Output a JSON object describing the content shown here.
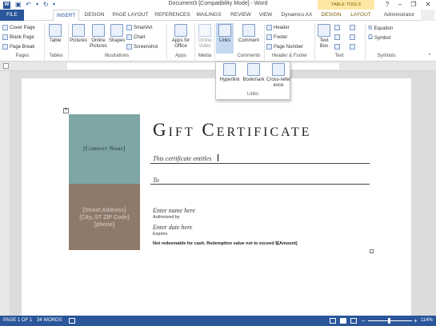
{
  "titlebar": {
    "title": "Document3 [Compatibility Mode] - Word",
    "contextual": "TABLE TOOLS",
    "help": "?",
    "min": "–",
    "restore": "❐",
    "close": "✕"
  },
  "tabs": {
    "file": "FILE",
    "insert": "INSERT",
    "design": "DESIGN",
    "page_layout": "PAGE LAYOUT",
    "references": "REFERENCES",
    "mailings": "MAILINGS",
    "review": "REVIEW",
    "view": "VIEW",
    "dynamics": "Dynamics AX",
    "tt_design": "DESIGN",
    "tt_layout": "LAYOUT",
    "user": "Administrator"
  },
  "ribbon": {
    "pages": {
      "cover": "Cover Page",
      "blank": "Blank Page",
      "break": "Page Break",
      "label": "Pages"
    },
    "tables": {
      "table": "Table",
      "label": "Tables"
    },
    "illustrations": {
      "pictures": "Pictures",
      "online_pictures": "Online Pictures",
      "shapes": "Shapes",
      "smartart": "SmartArt",
      "chart": "Chart",
      "screenshot": "Screenshot",
      "label": "Illustrations"
    },
    "apps": {
      "apps": "Apps for Office",
      "label": "Apps"
    },
    "media": {
      "video": "Online Video",
      "label": "Media"
    },
    "links": {
      "links": "Links"
    },
    "comments": {
      "comment": "Comment",
      "label": "Comments"
    },
    "header_footer": {
      "header": "Header",
      "footer": "Footer",
      "page_number": "Page Number",
      "label": "Header & Footer"
    },
    "text": {
      "textbox": "Text Box",
      "label": "Text"
    },
    "symbols": {
      "equation": "Equation",
      "symbol": "Symbol",
      "label": "Symbols"
    }
  },
  "links_dropdown": {
    "hyperlink": "Hyperlink",
    "bookmark": "Bookmark",
    "cross_ref": "Cross-reference",
    "label": "Links"
  },
  "document": {
    "company": "[Company Name]",
    "address": "[Street Address]",
    "city": "[City, ST  ZIP Code]",
    "phone": "[phone]",
    "title": "Gift Certificate",
    "entitles": "This certificate entitles",
    "to": "To",
    "name_placeholder": "Enter name here",
    "authorized": "Authorized by",
    "date_placeholder": "Enter date here",
    "expires": "Expires",
    "disclaimer": "Not redeemable for cash. Redemption value not to exceed $[Amount]"
  },
  "status": {
    "page": "PAGE 1 OF 1",
    "words": "34 WORDS",
    "zoom": "114%"
  }
}
